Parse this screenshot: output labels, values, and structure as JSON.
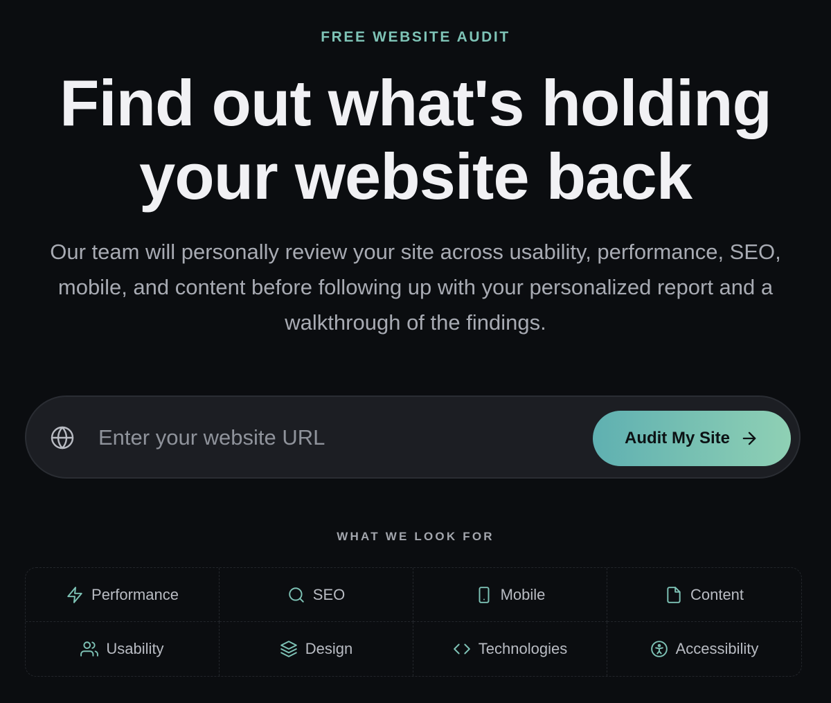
{
  "hero": {
    "eyebrow": "FREE WEBSITE AUDIT",
    "headline": "Find out what's holding your website back",
    "subhead": "Our team will personally review your site across usability, performance, SEO, mobile, and content before following up with your personalized report and a walkthrough of the findings."
  },
  "form": {
    "url_placeholder": "Enter your website URL",
    "url_value": "",
    "submit_label": "Audit My Site",
    "input_icon": "globe-icon",
    "submit_icon": "arrow-right-icon"
  },
  "features": {
    "section_label": "WHAT WE LOOK FOR",
    "items": [
      {
        "label": "Performance",
        "icon": "lightning-icon"
      },
      {
        "label": "SEO",
        "icon": "search-icon"
      },
      {
        "label": "Mobile",
        "icon": "smartphone-icon"
      },
      {
        "label": "Content",
        "icon": "document-icon"
      },
      {
        "label": "Usability",
        "icon": "users-icon"
      },
      {
        "label": "Design",
        "icon": "layers-icon"
      },
      {
        "label": "Technologies",
        "icon": "code-icon"
      },
      {
        "label": "Accessibility",
        "icon": "accessibility-icon"
      }
    ]
  },
  "colors": {
    "background": "#0b0d10",
    "accent": "#7ec3b6",
    "button_gradient_start": "#5fb0b1",
    "button_gradient_end": "#8fd0b4",
    "headline_text": "#f1f1f4",
    "body_text": "#a8abb3"
  }
}
